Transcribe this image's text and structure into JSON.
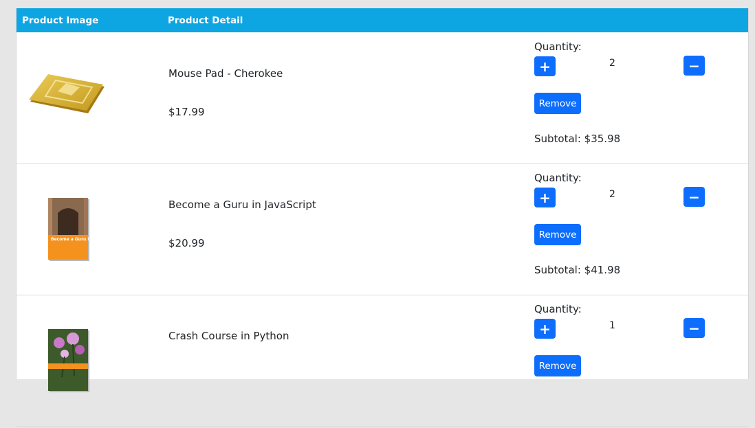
{
  "header": {
    "col_image": "Product Image",
    "col_detail": "Product Detail"
  },
  "labels": {
    "quantity": "Quantity:",
    "remove": "Remove",
    "plus": "+",
    "minus": "−",
    "subtotal_prefix": "Subtotal: "
  },
  "items": [
    {
      "name": "Mouse Pad - Cherokee",
      "price": "$17.99",
      "quantity": "2",
      "subtotal": "Subtotal: $35.98"
    },
    {
      "name": "Become a Guru in JavaScript",
      "price": "$20.99",
      "quantity": "2",
      "subtotal": "Subtotal: $41.98",
      "cover_title": "Become a Guru in JavaScript"
    },
    {
      "name": "Crash Course in Python",
      "price": "",
      "quantity": "1",
      "subtotal": ""
    }
  ],
  "colors": {
    "header_bg": "#0da5e2",
    "button": "#0d6efd"
  }
}
